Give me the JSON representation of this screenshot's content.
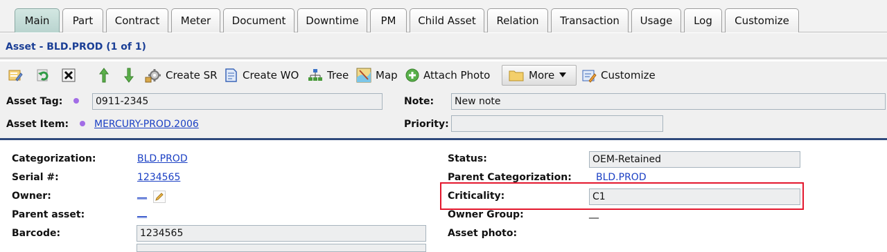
{
  "tabs": [
    {
      "label": "Main",
      "active": true
    },
    {
      "label": "Part"
    },
    {
      "label": "Contract"
    },
    {
      "label": "Meter"
    },
    {
      "label": "Document"
    },
    {
      "label": "Downtime"
    },
    {
      "label": "PM"
    },
    {
      "label": "Child Asset"
    },
    {
      "label": "Relation"
    },
    {
      "label": "Transaction"
    },
    {
      "label": "Usage"
    },
    {
      "label": "Log"
    },
    {
      "label": "Customize"
    }
  ],
  "page_title": "Asset - BLD.PROD (1 of 1)",
  "toolbar": {
    "create_sr": "Create SR",
    "create_wo": "Create WO",
    "tree": "Tree",
    "map": "Map",
    "attach_photo": "Attach Photo",
    "more": "More",
    "customize": "Customize"
  },
  "header": {
    "asset_tag_label": "Asset Tag:",
    "asset_tag_value": "0911-2345",
    "note_label": "Note:",
    "note_value": "New note",
    "asset_item_label": "Asset Item:",
    "asset_item_value": "MERCURY-PROD.2006",
    "priority_label": "Priority:",
    "priority_value": ""
  },
  "details": {
    "categorization_label": "Categorization:",
    "categorization_value": "BLD.PROD",
    "serial_label": "Serial #:",
    "serial_value": "1234565",
    "owner_label": "Owner:",
    "owner_value": "__",
    "parent_asset_label": "Parent asset:",
    "parent_asset_value": "__",
    "barcode_label": "Barcode:",
    "barcode_value": "1234565",
    "status_label": "Status:",
    "status_value": "OEM-Retained",
    "parent_categorization_label": "Parent Categorization:",
    "parent_categorization_value": "BLD.PROD",
    "criticality_label": "Criticality:",
    "criticality_value": "C1",
    "owner_group_label": "Owner Group:",
    "owner_group_value": "__",
    "asset_photo_label": "Asset photo:"
  },
  "colors": {
    "title": "#1b3f96",
    "link": "#1a3fc4",
    "highlight": "#e3162c",
    "required_dot": "#a26de6"
  }
}
